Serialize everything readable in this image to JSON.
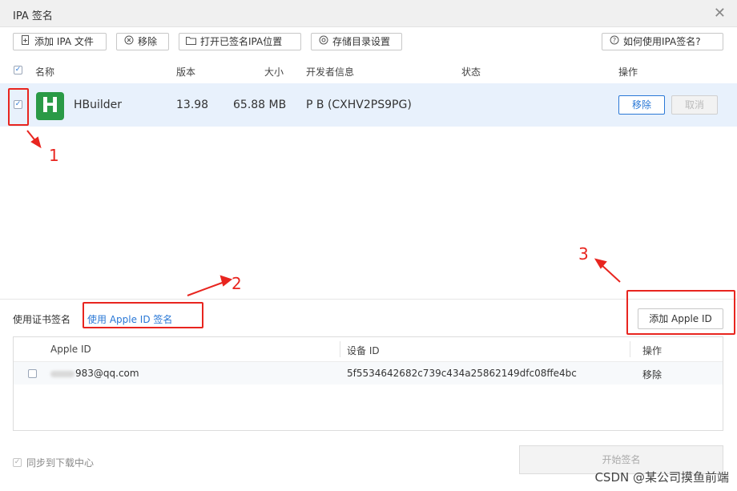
{
  "window": {
    "title": "IPA 签名",
    "close_glyph": "✕"
  },
  "toolbar": {
    "add_ipa": "添加 IPA 文件",
    "remove": "移除",
    "open_signed_location": "打开已签名IPA位置",
    "storage_settings": "存储目录设置",
    "how_to_sign": "如何使用IPA签名?"
  },
  "table": {
    "headers": {
      "name": "名称",
      "version": "版本",
      "size": "大小",
      "developer": "开发者信息",
      "status": "状态",
      "actions": "操作"
    },
    "rows": [
      {
        "checked": true,
        "logo_letter": "H",
        "name": "HBuilder",
        "version": "13.98",
        "size": "65.88 MB",
        "developer": "P B (CXHV2PS9PG)",
        "status": "",
        "remove_label": "移除",
        "cancel_label": "取消"
      }
    ]
  },
  "sign_tabs": {
    "cert": "使用证书签名",
    "apple_id": "使用 Apple ID 签名"
  },
  "add_apple_id": "添加 Apple ID",
  "apple_grid": {
    "headers": {
      "apple_id": "Apple ID",
      "device_id": "设备 ID",
      "actions": "操作"
    },
    "rows": [
      {
        "apple_id": "983@qq.com",
        "device_id": "5f5534642682c739c434a25862149dfc08ffe4bc",
        "action": "移除"
      }
    ]
  },
  "footer": {
    "sync": "同步到下载中心",
    "start_sign": "开始签名"
  },
  "watermark": "CSDN @某公司摸鱼前端",
  "annotations": {
    "n1": "1",
    "n2": "2",
    "n3": "3"
  },
  "colors": {
    "accent": "#2a78d6",
    "annotation_red": "#e8251f",
    "selected_row": "#e8f1fc",
    "app_logo": "#2a9a46"
  }
}
